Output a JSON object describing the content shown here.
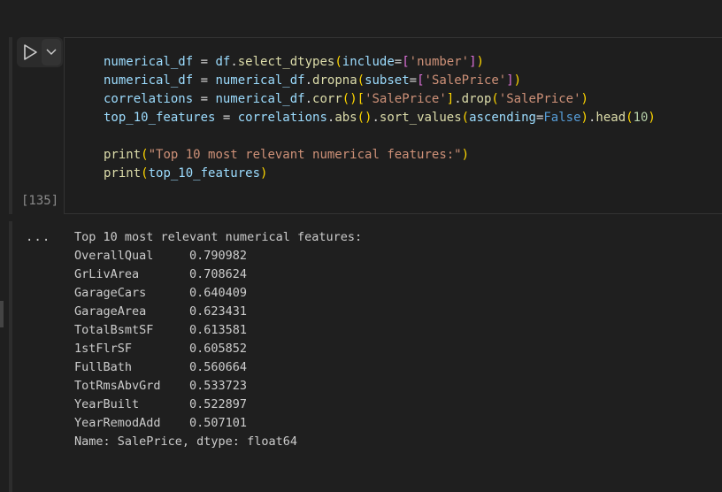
{
  "cell": {
    "execution_count": "[135]",
    "code_lines": [
      [
        [
          "v",
          "numerical_df"
        ],
        [
          "p",
          " = "
        ],
        [
          "v",
          "df"
        ],
        [
          "p",
          "."
        ],
        [
          "f",
          "select_dtypes"
        ],
        [
          "b1",
          "("
        ],
        [
          "v",
          "include"
        ],
        [
          "p",
          "="
        ],
        [
          "b2",
          "["
        ],
        [
          "s",
          "'number'"
        ],
        [
          "b2",
          "]"
        ],
        [
          "b1",
          ")"
        ]
      ],
      [
        [
          "v",
          "numerical_df"
        ],
        [
          "p",
          " = "
        ],
        [
          "v",
          "numerical_df"
        ],
        [
          "p",
          "."
        ],
        [
          "f",
          "dropna"
        ],
        [
          "b1",
          "("
        ],
        [
          "v",
          "subset"
        ],
        [
          "p",
          "="
        ],
        [
          "b2",
          "["
        ],
        [
          "s",
          "'SalePrice'"
        ],
        [
          "b2",
          "]"
        ],
        [
          "b1",
          ")"
        ]
      ],
      [
        [
          "v",
          "correlations"
        ],
        [
          "p",
          " = "
        ],
        [
          "v",
          "numerical_df"
        ],
        [
          "p",
          "."
        ],
        [
          "f",
          "corr"
        ],
        [
          "b1",
          "()"
        ],
        [
          "b1",
          "["
        ],
        [
          "s",
          "'SalePrice'"
        ],
        [
          "b1",
          "]"
        ],
        [
          "p",
          "."
        ],
        [
          "f",
          "drop"
        ],
        [
          "b1",
          "("
        ],
        [
          "s",
          "'SalePrice'"
        ],
        [
          "b1",
          ")"
        ]
      ],
      [
        [
          "v",
          "top_10_features"
        ],
        [
          "p",
          " = "
        ],
        [
          "v",
          "correlations"
        ],
        [
          "p",
          "."
        ],
        [
          "f",
          "abs"
        ],
        [
          "b1",
          "()"
        ],
        [
          "p",
          "."
        ],
        [
          "f",
          "sort_values"
        ],
        [
          "b1",
          "("
        ],
        [
          "v",
          "ascending"
        ],
        [
          "p",
          "="
        ],
        [
          "k",
          "False"
        ],
        [
          "b1",
          ")"
        ],
        [
          "p",
          "."
        ],
        [
          "f",
          "head"
        ],
        [
          "b1",
          "("
        ],
        [
          "n",
          "10"
        ],
        [
          "b1",
          ")"
        ]
      ],
      [],
      [
        [
          "f",
          "print"
        ],
        [
          "b1",
          "("
        ],
        [
          "s",
          "\"Top 10 most relevant numerical features:\""
        ],
        [
          "b1",
          ")"
        ]
      ],
      [
        [
          "f",
          "print"
        ],
        [
          "b1",
          "("
        ],
        [
          "v",
          "top_10_features"
        ],
        [
          "b1",
          ")"
        ]
      ]
    ]
  },
  "output": {
    "more_label": "...",
    "lines": [
      "Top 10 most relevant numerical features:",
      "OverallQual     0.790982",
      "GrLivArea       0.708624",
      "GarageCars      0.640409",
      "GarageArea      0.623431",
      "TotalBsmtSF     0.613581",
      "1stFlrSF        0.605852",
      "FullBath        0.560664",
      "TotRmsAbvGrd    0.533723",
      "YearBuilt       0.522897",
      "YearRemodAdd    0.507101",
      "Name: SalePrice, dtype: float64"
    ]
  }
}
